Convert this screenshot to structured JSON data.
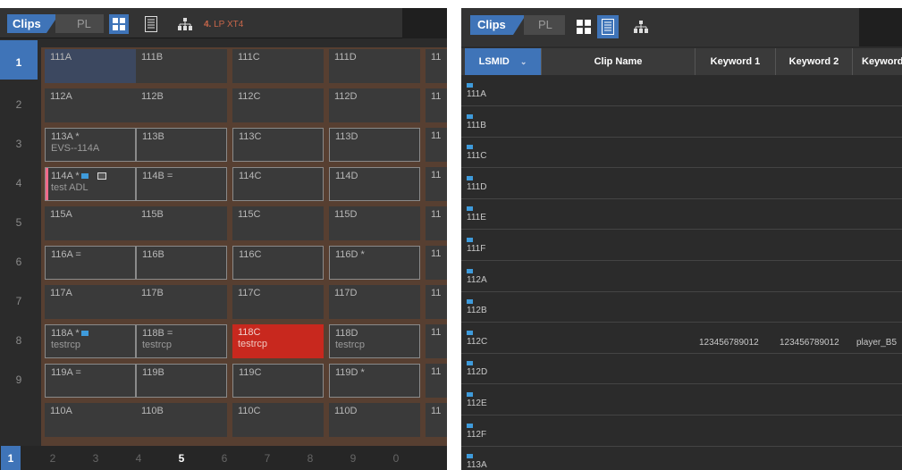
{
  "left": {
    "tab_clips": "Clips",
    "tab_pl": "PL",
    "lp_label_num": "4.",
    "lp_label_text": "LP XT4",
    "row_numbers": [
      "1",
      "2",
      "3",
      "4",
      "5",
      "6",
      "7",
      "8",
      "9"
    ],
    "active_row": "1",
    "grid": [
      [
        {
          "l1": "111A"
        },
        {
          "l1": "111B"
        },
        {
          "l1": "111C"
        },
        {
          "l1": "111D"
        },
        {
          "l1": "11"
        }
      ],
      [
        {
          "l1": "112A"
        },
        {
          "l1": "112B"
        },
        {
          "l1": "112C"
        },
        {
          "l1": "112D"
        },
        {
          "l1": "11"
        }
      ],
      [
        {
          "l1": "113A *",
          "l2": "EVS--114A"
        },
        {
          "l1": "113B"
        },
        {
          "l1": "113C"
        },
        {
          "l1": "113D"
        },
        {
          "l1": "11"
        }
      ],
      [
        {
          "l1": "114A *",
          "l2": "test ADL"
        },
        {
          "l1": "114B ="
        },
        {
          "l1": "114C"
        },
        {
          "l1": "114D"
        },
        {
          "l1": "11"
        }
      ],
      [
        {
          "l1": "115A"
        },
        {
          "l1": "115B"
        },
        {
          "l1": "115C"
        },
        {
          "l1": "115D"
        },
        {
          "l1": "11"
        }
      ],
      [
        {
          "l1": "116A ="
        },
        {
          "l1": "116B"
        },
        {
          "l1": "116C"
        },
        {
          "l1": "116D *"
        },
        {
          "l1": "11"
        }
      ],
      [
        {
          "l1": "117A"
        },
        {
          "l1": "117B"
        },
        {
          "l1": "117C"
        },
        {
          "l1": "117D"
        },
        {
          "l1": "11"
        }
      ],
      [
        {
          "l1": "118A *",
          "l2": "testrcp"
        },
        {
          "l1": "118B =",
          "l2": "testrcp"
        },
        {
          "l1": "118C",
          "l2": "testrcp"
        },
        {
          "l1": "118D",
          "l2": "testrcp"
        },
        {
          "l1": "11"
        }
      ],
      [
        {
          "l1": "119A ="
        },
        {
          "l1": "119B"
        },
        {
          "l1": "119C"
        },
        {
          "l1": "119D *"
        },
        {
          "l1": "11"
        }
      ],
      [
        {
          "l1": "110A"
        },
        {
          "l1": "110B"
        },
        {
          "l1": "110C"
        },
        {
          "l1": "110D"
        },
        {
          "l1": "11"
        }
      ]
    ],
    "pages": [
      "1",
      "2",
      "3",
      "4",
      "5",
      "6",
      "7",
      "8",
      "9",
      "0"
    ],
    "active_page": "1",
    "bold_page": "5"
  },
  "right": {
    "tab_clips": "Clips",
    "tab_pl": "PL",
    "columns": [
      "LSMID",
      "Clip Name",
      "Keyword 1",
      "Keyword 2",
      "Keyword"
    ],
    "sort_indicator": "⌄",
    "rows": [
      {
        "lsmid": "111A"
      },
      {
        "lsmid": "111B"
      },
      {
        "lsmid": "111C"
      },
      {
        "lsmid": "111D"
      },
      {
        "lsmid": "111E"
      },
      {
        "lsmid": "111F"
      },
      {
        "lsmid": "112A"
      },
      {
        "lsmid": "112B"
      },
      {
        "lsmid": "112C",
        "kw1": "123456789012",
        "kw2": "123456789012",
        "kw3": "player_B5"
      },
      {
        "lsmid": "112D"
      },
      {
        "lsmid": "112E"
      },
      {
        "lsmid": "112F"
      },
      {
        "lsmid": "113A"
      }
    ]
  },
  "colors": {
    "accent": "#3f74b8",
    "grid_divider": "#573f31",
    "cell_red": "#c8281e",
    "lp_orange": "#c8664a",
    "folder_blue": "#3f9bdb",
    "pink_marker": "#f06a8a"
  },
  "icons": {
    "grid_view": "grid-view-icon",
    "list_view": "list-view-icon",
    "tree_view": "hierarchy-icon"
  }
}
